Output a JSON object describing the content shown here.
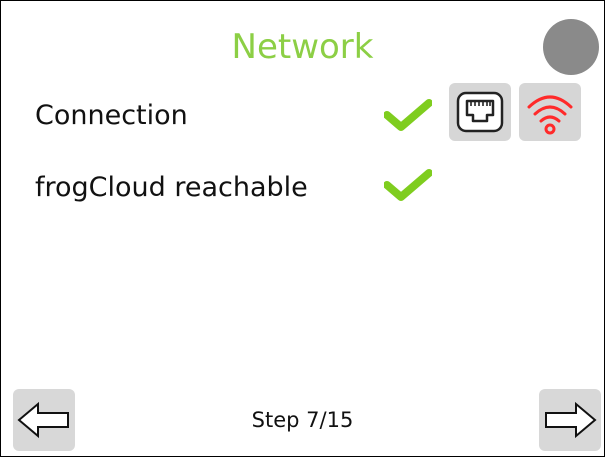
{
  "title": "Network",
  "rows": [
    {
      "label": "Connection",
      "status": "ok"
    },
    {
      "label": "frogCloud reachable",
      "status": "ok"
    }
  ],
  "icons": {
    "status_dot": "status-dot",
    "ethernet": "ethernet-port-icon",
    "wifi": "wifi-icon",
    "check": "checkmark-icon",
    "prev": "arrow-left-icon",
    "next": "arrow-right-icon"
  },
  "colors": {
    "title": "#8ccf45",
    "check": "#7fcd1f",
    "wifi": "#ff2a2a",
    "status_dot": "#8a8a8a",
    "button_bg": "#d8d8d8"
  },
  "footer": {
    "step_text": "Step 7/15"
  }
}
